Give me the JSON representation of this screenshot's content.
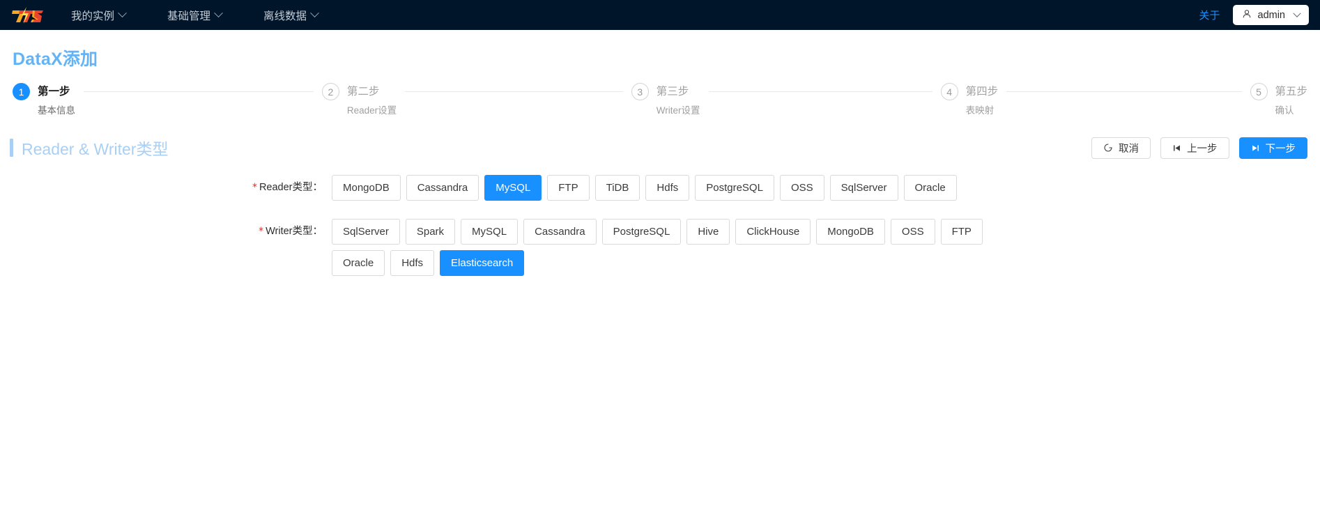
{
  "nav": {
    "logo_alt": "ts-lightning-logo",
    "items": [
      {
        "label": "我的实例",
        "has_caret": true
      },
      {
        "label": "基础管理",
        "has_caret": true
      },
      {
        "label": "离线数据",
        "has_caret": true
      }
    ],
    "about": "关于",
    "user": "admin"
  },
  "page": {
    "title": "DataX添加"
  },
  "steps": [
    {
      "num": "1",
      "title": "第一步",
      "desc": "基本信息",
      "active": true
    },
    {
      "num": "2",
      "title": "第二步",
      "desc": "Reader设置",
      "active": false
    },
    {
      "num": "3",
      "title": "第三步",
      "desc": "Writer设置",
      "active": false
    },
    {
      "num": "4",
      "title": "第四步",
      "desc": "表映射",
      "active": false
    },
    {
      "num": "5",
      "title": "第五步",
      "desc": "确认",
      "active": false
    }
  ],
  "section": {
    "title": "Reader & Writer类型"
  },
  "toolbar": {
    "cancel_label": "取消",
    "prev_label": "上一步",
    "next_label": "下一步"
  },
  "form": {
    "reader": {
      "label": "Reader类型：",
      "required": true,
      "options": [
        "MongoDB",
        "Cassandra",
        "MySQL",
        "FTP",
        "TiDB",
        "Hdfs",
        "PostgreSQL",
        "OSS",
        "SqlServer",
        "Oracle"
      ],
      "selected": "MySQL"
    },
    "writer": {
      "label": "Writer类型：",
      "required": true,
      "options": [
        "SqlServer",
        "Spark",
        "MySQL",
        "Cassandra",
        "PostgreSQL",
        "Hive",
        "ClickHouse",
        "MongoDB",
        "OSS",
        "FTP",
        "Oracle",
        "Hdfs",
        "Elasticsearch"
      ],
      "selected": "Elasticsearch"
    }
  },
  "colors": {
    "nav_bg": "#001529",
    "primary": "#1890ff",
    "title_blue": "#63b3f7",
    "section_blue": "#a9cff5",
    "required_red": "#f5222d"
  }
}
